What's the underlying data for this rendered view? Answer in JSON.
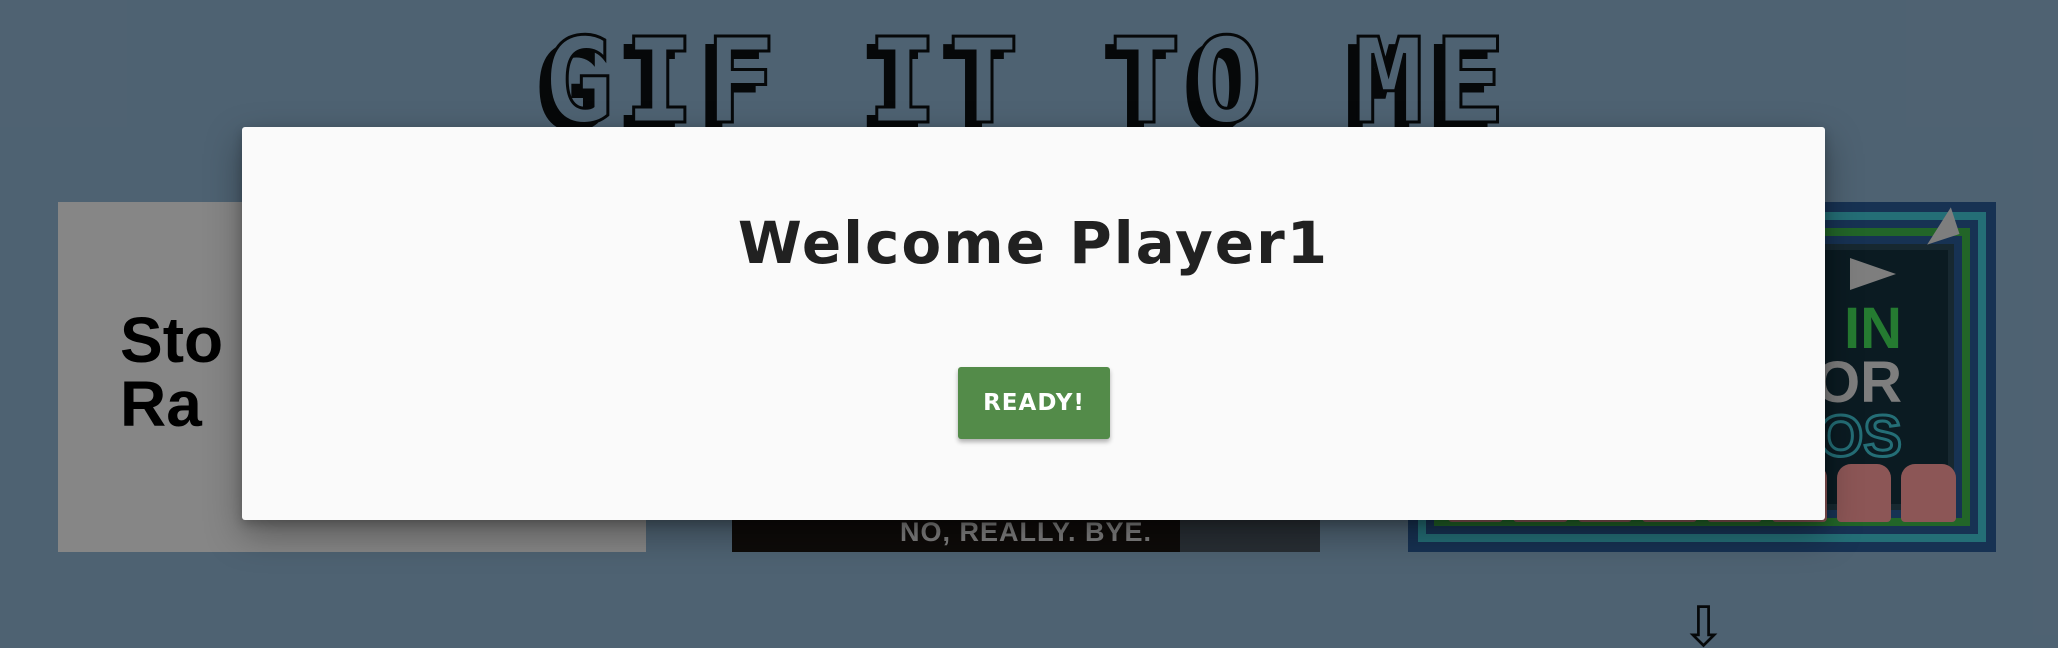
{
  "site": {
    "title": "GIF IT TO ME",
    "scroll_down_glyph": "⇩"
  },
  "gif_cards": [
    {
      "text": "Sto\nRa"
    },
    {
      "caption": "NO, REALLY. BYE."
    },
    {
      "lines": [
        "IN",
        "OR",
        "OS"
      ]
    }
  ],
  "modal": {
    "title": "Welcome Player1",
    "ready_label": "READY!"
  },
  "colors": {
    "page_background": "#8fb2cf",
    "modal_background": "#fafafa",
    "ready_button": "#538b49",
    "title_text": "#212121"
  }
}
